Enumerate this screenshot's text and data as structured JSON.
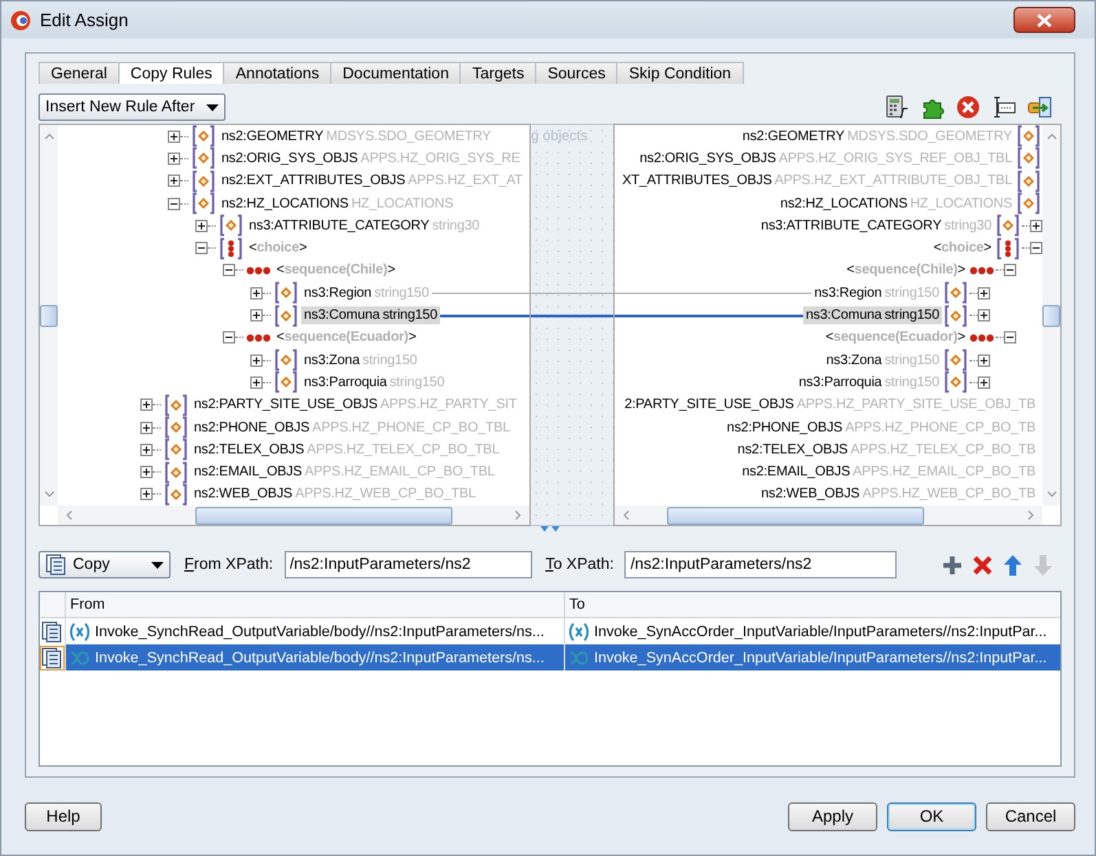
{
  "window": {
    "title": "Edit Assign"
  },
  "tabs": [
    {
      "label": "General",
      "selected": false
    },
    {
      "label": "Copy Rules",
      "selected": true
    },
    {
      "label": "Annotations",
      "selected": false
    },
    {
      "label": "Documentation",
      "selected": false
    },
    {
      "label": "Targets",
      "selected": false
    },
    {
      "label": "Sources",
      "selected": false
    },
    {
      "label": "Skip Condition",
      "selected": false
    }
  ],
  "rule_mode": {
    "value": "Insert New Rule After"
  },
  "source_tree": {
    "partial_branch": [
      {
        "kind": "element",
        "name": "ns2:GEOMETRY",
        "type": "MDSYS.SDO_GEOMETRY",
        "expanded": false,
        "mapped": false,
        "selected": false
      },
      {
        "kind": "element",
        "name": "ns2:ORIG_SYS_OBJS",
        "type": "APPS.HZ_ORIG_SYS_RE",
        "expanded": false,
        "mapped": false,
        "selected": false
      },
      {
        "kind": "element",
        "name": "ns2:EXT_ATTRIBUTES_OBJS",
        "type": "APPS.HZ_EXT_AT",
        "expanded": false,
        "mapped": false,
        "selected": false
      },
      {
        "kind": "element",
        "name": "ns2:HZ_LOCATIONS",
        "type": "HZ_LOCATIONS",
        "expanded": true,
        "mapped": false,
        "selected": false,
        "children": [
          {
            "kind": "element",
            "name": "ns3:ATTRIBUTE_CATEGORY",
            "type": "string30",
            "expanded": false,
            "mapped": false,
            "selected": false
          },
          {
            "kind": "choice",
            "name": "<**choice**>",
            "expanded": true,
            "mapped": false,
            "selected": false,
            "children": [
              {
                "kind": "sequence",
                "name": "<**sequence(Chile)**>",
                "expanded": true,
                "mapped": false,
                "selected": false,
                "children": [
                  {
                    "kind": "element",
                    "name": "ns3:Region",
                    "type": "string150",
                    "expanded": false,
                    "mapped": true,
                    "selected": false
                  },
                  {
                    "kind": "element",
                    "name": "ns3:Comuna",
                    "type": "string150",
                    "expanded": false,
                    "mapped": true,
                    "selected": true
                  }
                ]
              },
              {
                "kind": "sequence",
                "name": "<**sequence(Ecuador)**>",
                "expanded": true,
                "mapped": false,
                "selected": false,
                "children": [
                  {
                    "kind": "element",
                    "name": "ns3:Zona",
                    "type": "string150",
                    "expanded": false,
                    "mapped": false,
                    "selected": false
                  },
                  {
                    "kind": "element",
                    "name": "ns3:Parroquia",
                    "type": "string150",
                    "expanded": false,
                    "mapped": false,
                    "selected": false
                  }
                ]
              }
            ]
          }
        ]
      }
    ],
    "items": [
      {
        "kind": "element",
        "name": "ns2:PARTY_SITE_USE_OBJS",
        "type": "APPS.HZ_PARTY_SIT",
        "expanded": false,
        "mapped": false,
        "selected": false
      },
      {
        "kind": "element",
        "name": "ns2:PHONE_OBJS",
        "type": "APPS.HZ_PHONE_CP_BO_TBL",
        "expanded": false,
        "mapped": false,
        "selected": false
      },
      {
        "kind": "element",
        "name": "ns2:TELEX_OBJS",
        "type": "APPS.HZ_TELEX_CP_BO_TBL",
        "expanded": false,
        "mapped": false,
        "selected": false
      },
      {
        "kind": "element",
        "name": "ns2:EMAIL_OBJS",
        "type": "APPS.HZ_EMAIL_CP_BO_TBL",
        "expanded": false,
        "mapped": false,
        "selected": false
      },
      {
        "kind": "element",
        "name": "ns2:WEB_OBJS",
        "type": "APPS.HZ_WEB_CP_BO_TBL",
        "expanded": false,
        "mapped": false,
        "selected": false
      }
    ]
  },
  "mapping_area": {
    "caption": "g objects"
  },
  "target_tree": {
    "partial_branch": [
      {
        "kind": "element",
        "name": "ns2:GEOMETRY",
        "type": "MDSYS.SDO_GEOMETRY",
        "mapped": false,
        "selected": false
      },
      {
        "kind": "element",
        "name": "ns2:ORIG_SYS_OBJS",
        "type": "APPS.HZ_ORIG_SYS_REF_OBJ_TBL",
        "mapped": false,
        "selected": false
      },
      {
        "kind": "element",
        "name": "XT_ATTRIBUTES_OBJS",
        "type": "APPS.HZ_EXT_ATTRIBUTE_OBJ_TBL",
        "mapped": false,
        "selected": false
      },
      {
        "kind": "element",
        "name": "ns2:HZ_LOCATIONS",
        "type": "HZ_LOCATIONS",
        "mapped": false,
        "selected": false,
        "children": [
          {
            "kind": "element",
            "name": "ns3:ATTRIBUTE_CATEGORY",
            "type": "string30",
            "expanded": false,
            "mapped": false,
            "selected": false
          },
          {
            "kind": "choice",
            "name": "<**choice**>",
            "expanded": true,
            "mapped": false,
            "selected": false,
            "children": [
              {
                "kind": "sequence",
                "name": "<**sequence(Chile)**>",
                "expanded": true,
                "mapped": false,
                "selected": false,
                "children": [
                  {
                    "kind": "element",
                    "name": "ns3:Region",
                    "type": "string150",
                    "expanded": false,
                    "mapped": true,
                    "selected": false
                  },
                  {
                    "kind": "element",
                    "name": "ns3:Comuna",
                    "type": "string150",
                    "expanded": false,
                    "mapped": true,
                    "selected": true
                  }
                ]
              },
              {
                "kind": "sequence",
                "name": "<**sequence(Ecuador)**>",
                "expanded": true,
                "mapped": false,
                "selected": false,
                "children": [
                  {
                    "kind": "element",
                    "name": "ns3:Zona",
                    "type": "string150",
                    "expanded": false,
                    "mapped": false,
                    "selected": false
                  },
                  {
                    "kind": "element",
                    "name": "ns3:Parroquia",
                    "type": "string150",
                    "expanded": false,
                    "mapped": false,
                    "selected": false
                  }
                ]
              }
            ]
          }
        ]
      }
    ],
    "items": [
      {
        "name": "2:PARTY_SITE_USE_OBJS",
        "type": "APPS.HZ_PARTY_SITE_USE_OBJ_TB",
        "mapped": false,
        "selected": false
      },
      {
        "name": "ns2:PHONE_OBJS",
        "type": "APPS.HZ_PHONE_CP_BO_TB",
        "mapped": false,
        "selected": false
      },
      {
        "name": "ns2:TELEX_OBJS",
        "type": "APPS.HZ_TELEX_CP_BO_TB",
        "mapped": false,
        "selected": false
      },
      {
        "name": "ns2:EMAIL_OBJS",
        "type": "APPS.HZ_EMAIL_CP_BO_TB",
        "mapped": false,
        "selected": false
      },
      {
        "name": "ns2:WEB_OBJS",
        "type": "APPS.HZ_WEB_CP_BO_TB",
        "mapped": false,
        "selected": false
      }
    ]
  },
  "rule_editor": {
    "operation": "Copy",
    "from_label": "From XPath:",
    "from_xpath": "/ns2:InputParameters/ns2",
    "to_label": "To XPath:",
    "to_xpath": "/ns2:InputParameters/ns2",
    "move_down_disabled": true
  },
  "table": {
    "columns": [
      "From",
      "To"
    ],
    "rows": [
      {
        "kind": "variable",
        "from": "Invoke_SynchRead_OutputVariable/body//ns2:InputParameters/ns...",
        "to": "Invoke_SynAccOrder_InputVariable/InputParameters//ns2:InputPar...",
        "selected": false
      },
      {
        "kind": "expression",
        "from": "Invoke_SynchRead_OutputVariable/body//ns2:InputParameters/ns...",
        "to": "Invoke_SynAccOrder_InputVariable/InputParameters//ns2:InputPar...",
        "selected": true
      }
    ]
  },
  "help_button": {
    "label": "Help"
  },
  "buttons": [
    {
      "label": "Apply",
      "default": false
    },
    {
      "label": "OK",
      "default": true
    },
    {
      "label": "Cancel",
      "default": false
    }
  ]
}
